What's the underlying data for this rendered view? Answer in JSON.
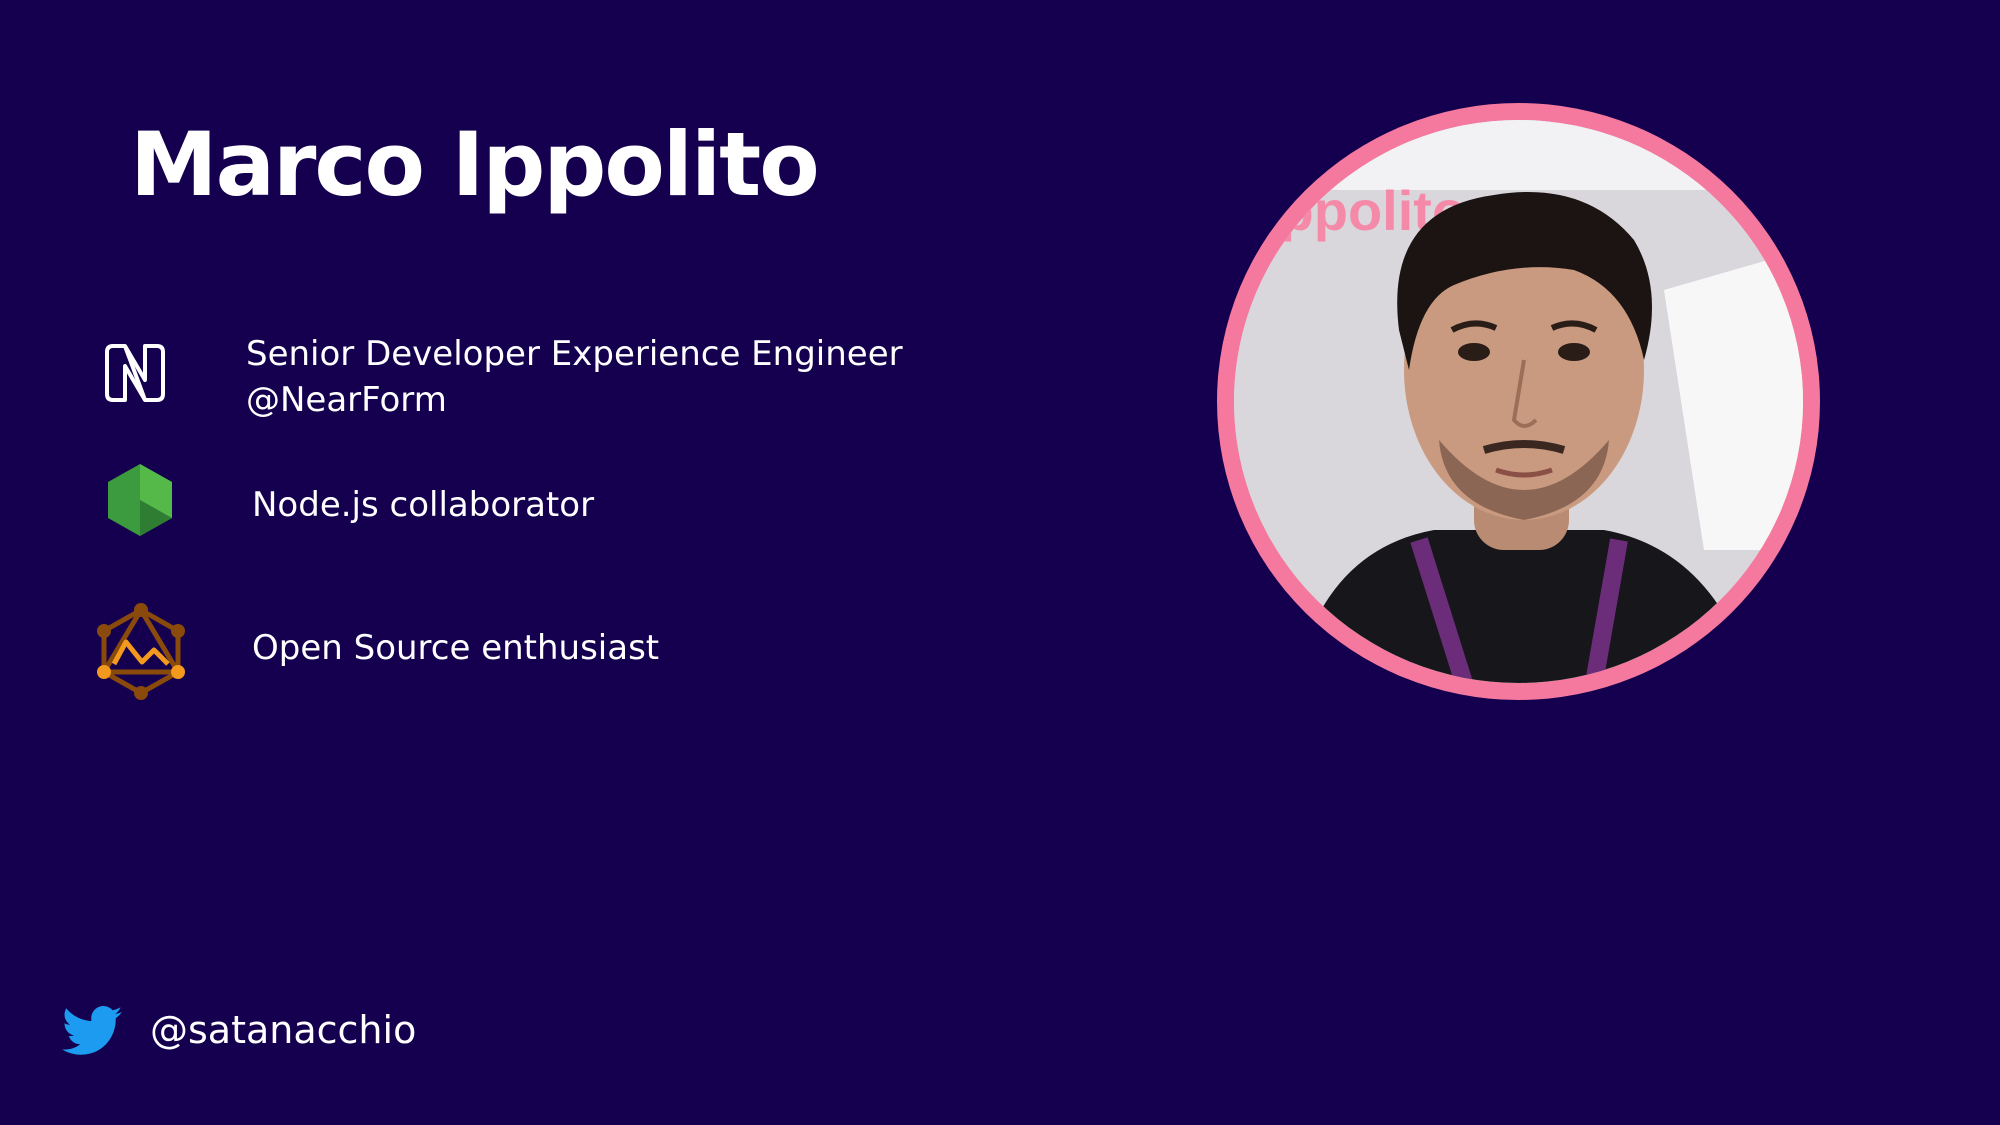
{
  "slide": {
    "title": "Marco Ippolito",
    "background_color": "#14004e",
    "accent_color": "#f5799f",
    "items": [
      {
        "icon": "nearform-logo-icon",
        "lines": [
          "Senior Developer Experience Engineer",
          "@NearForm"
        ]
      },
      {
        "icon": "nodejs-logo-icon",
        "lines": [
          "Node.js collaborator"
        ]
      },
      {
        "icon": "open-source-graph-icon",
        "lines": [
          "Open Source enthusiast"
        ]
      }
    ],
    "social": {
      "icon": "twitter-icon",
      "handle": "@satanacchio"
    },
    "photo": {
      "icon": "speaker-photo",
      "backdrop_text": "ippolito"
    }
  }
}
